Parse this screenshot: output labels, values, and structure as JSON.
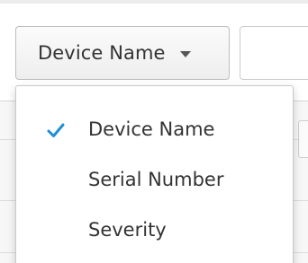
{
  "filter": {
    "button_label": "Device Name",
    "caret_icon": "caret-down-icon",
    "search_placeholder": ""
  },
  "menu": {
    "items": [
      {
        "label": "Device Name",
        "selected": true,
        "icon": "check-icon"
      },
      {
        "label": "Serial Number",
        "selected": false
      },
      {
        "label": "Severity",
        "selected": false
      }
    ]
  },
  "colors": {
    "check": "#1e8fd6",
    "text": "#333333",
    "border": "#bdbdbd"
  }
}
